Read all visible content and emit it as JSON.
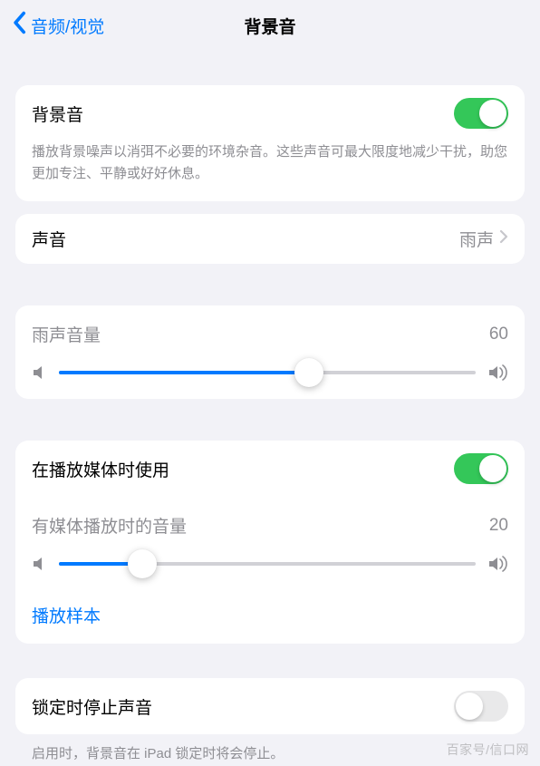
{
  "nav": {
    "back_label": "音频/视觉",
    "title": "背景音"
  },
  "main_toggle": {
    "label": "背景音",
    "on": true,
    "desc": "播放背景噪声以消弭不必要的环境杂音。这些声音可最大限度地减少干扰，助您更加专注、平静或好好休息。"
  },
  "sound": {
    "label": "声音",
    "value": "雨声"
  },
  "volume": {
    "label": "雨声音量",
    "value": "60",
    "pct": 60
  },
  "media": {
    "toggle_label": "在播放媒体时使用",
    "toggle_on": true,
    "vol_label": "有媒体播放时的音量",
    "vol_value": "20",
    "vol_pct": 20,
    "sample_label": "播放样本"
  },
  "lock": {
    "label": "锁定时停止声音",
    "on": false,
    "desc": "启用时，背景音在 iPad 锁定时将会停止。"
  },
  "watermark": "百家号/信口网"
}
